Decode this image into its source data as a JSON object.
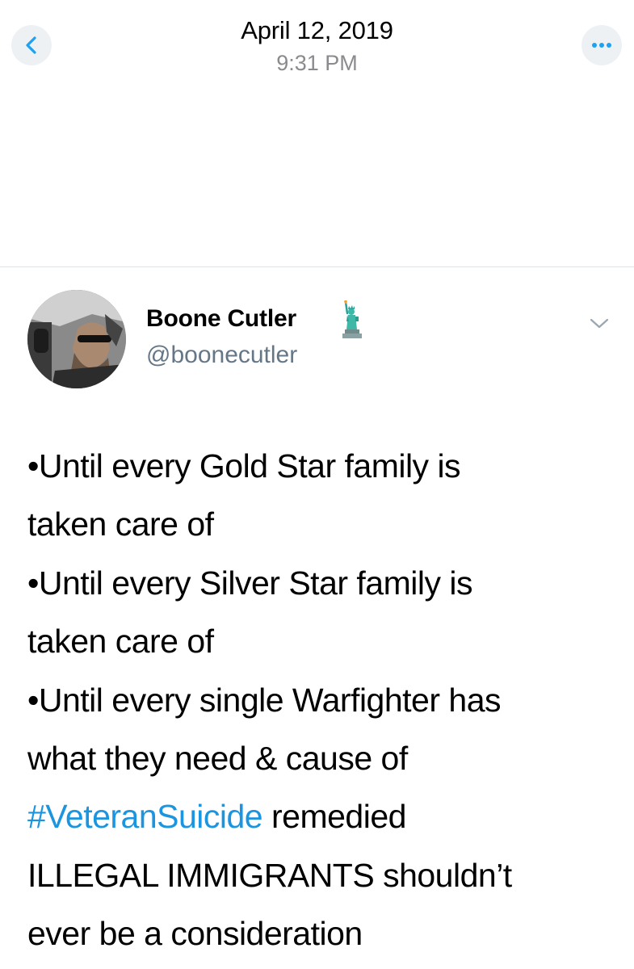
{
  "header": {
    "date": "April 12, 2019",
    "time": "9:31 PM",
    "back_icon": "chevron-left-icon",
    "more_icon": "ellipsis-icon"
  },
  "tweet": {
    "display_name": "Boone Cutler",
    "handle": "@boonecutler",
    "name_emoji": "statue-of-liberty",
    "menu_icon": "chevron-down-icon",
    "lines": [
      "•Until every Gold Star family is",
      "taken care of",
      "•Until every Silver Star family is",
      "taken care of",
      "•Until every single Warfighter has",
      "what they need & cause of"
    ],
    "hashtag": "#VeteranSuicide",
    "after_hashtag": " remedied",
    "lines_after": [
      "ILLEGAL IMMIGRANTS shouldn’t",
      "ever be a consideration"
    ]
  },
  "colors": {
    "link": "#1b95e0",
    "secondary_text": "#657786",
    "timestamp_gray": "#8b8b8f",
    "button_bg": "#eef1f4",
    "accent_icon": "#1da1f2"
  }
}
